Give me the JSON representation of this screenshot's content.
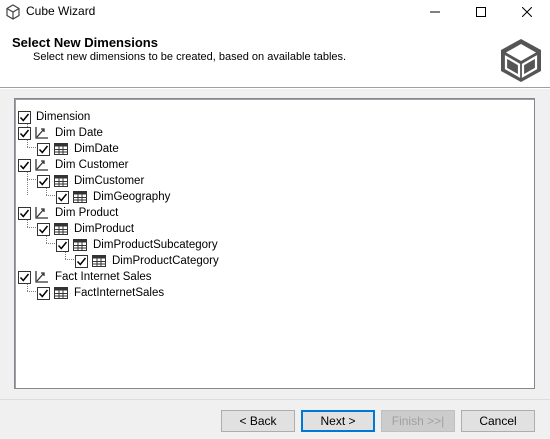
{
  "window": {
    "title": "Cube Wizard"
  },
  "header": {
    "title": "Select New Dimensions",
    "subtitle": "Select new dimensions to be created, based on available tables."
  },
  "tree": {
    "root": {
      "label": "Dimension",
      "checked": true
    },
    "items": [
      {
        "label": "Dim Date",
        "type": "dimension",
        "checked": true
      },
      {
        "label": "DimDate",
        "type": "table",
        "checked": true
      },
      {
        "label": "Dim Customer",
        "type": "dimension",
        "checked": true
      },
      {
        "label": "DimCustomer",
        "type": "table",
        "checked": true
      },
      {
        "label": "DimGeography",
        "type": "table",
        "checked": true
      },
      {
        "label": "Dim Product",
        "type": "dimension",
        "checked": true
      },
      {
        "label": "DimProduct",
        "type": "table",
        "checked": true
      },
      {
        "label": "DimProductSubcategory",
        "type": "table",
        "checked": true
      },
      {
        "label": "DimProductCategory",
        "type": "table",
        "checked": true
      },
      {
        "label": "Fact Internet Sales",
        "type": "dimension",
        "checked": true
      },
      {
        "label": "FactInternetSales",
        "type": "table",
        "checked": true
      }
    ]
  },
  "buttons": {
    "back": "< Back",
    "next": "Next >",
    "finish": "Finish >>|",
    "cancel": "Cancel"
  }
}
